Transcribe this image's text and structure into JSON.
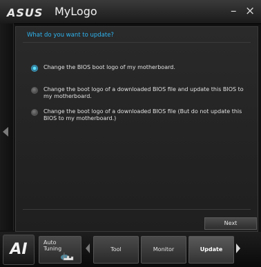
{
  "window": {
    "brand": "ASUS",
    "title": "MyLogo",
    "minimize_label": "–",
    "close_label": "×"
  },
  "panel": {
    "question": "What do you want to update?",
    "options": [
      {
        "label": "Change the BIOS boot logo of my motherboard.",
        "selected": true
      },
      {
        "label": "Change the boot logo of a downloaded BIOS file and update this BIOS to my motherboard.",
        "selected": false
      },
      {
        "label": "Change the boot logo of a downloaded BIOS file (But do not update this BIOS to my motherboard.)",
        "selected": false
      }
    ],
    "next_label": "Next"
  },
  "toolbar": {
    "ai_label": "AI",
    "auto_tuning_label": "Auto Tuning",
    "tool_label": "Tool",
    "monitor_label": "Monitor",
    "update_label": "Update",
    "active_tab": "Update"
  },
  "icons": {
    "side_nav": "chevron-left-icon",
    "auto_tuning": "hand-pointer-icon",
    "next_panel": "chevron-right-icon"
  },
  "colors": {
    "accent": "#2fb3ee",
    "background": "#121212",
    "panel": "#262626"
  }
}
